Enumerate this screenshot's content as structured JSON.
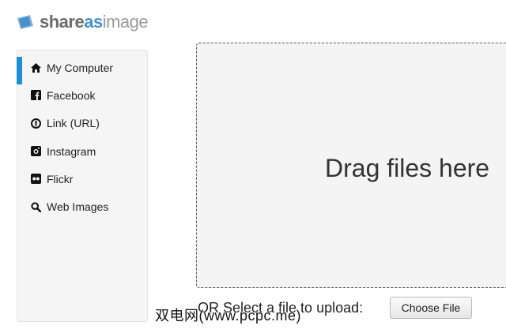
{
  "logo": {
    "share": "share",
    "as": "as",
    "image": "image"
  },
  "sidebar": {
    "items": [
      {
        "label": "My Computer",
        "icon": "home-icon",
        "active": true
      },
      {
        "label": "Facebook",
        "icon": "facebook-icon"
      },
      {
        "label": "Link (URL)",
        "icon": "link-icon"
      },
      {
        "label": "Instagram",
        "icon": "instagram-icon"
      },
      {
        "label": "Flickr",
        "icon": "flickr-icon"
      },
      {
        "label": "Web Images",
        "icon": "search-icon"
      }
    ]
  },
  "dropzone": {
    "text": "Drag files here"
  },
  "upload": {
    "label": "OR Select a file to upload:",
    "button": "Choose File"
  },
  "watermark": "双电网(www.pcpc.me)",
  "colors": {
    "accent": "#1c8fd6",
    "logo_blue": "#4a90c8"
  }
}
